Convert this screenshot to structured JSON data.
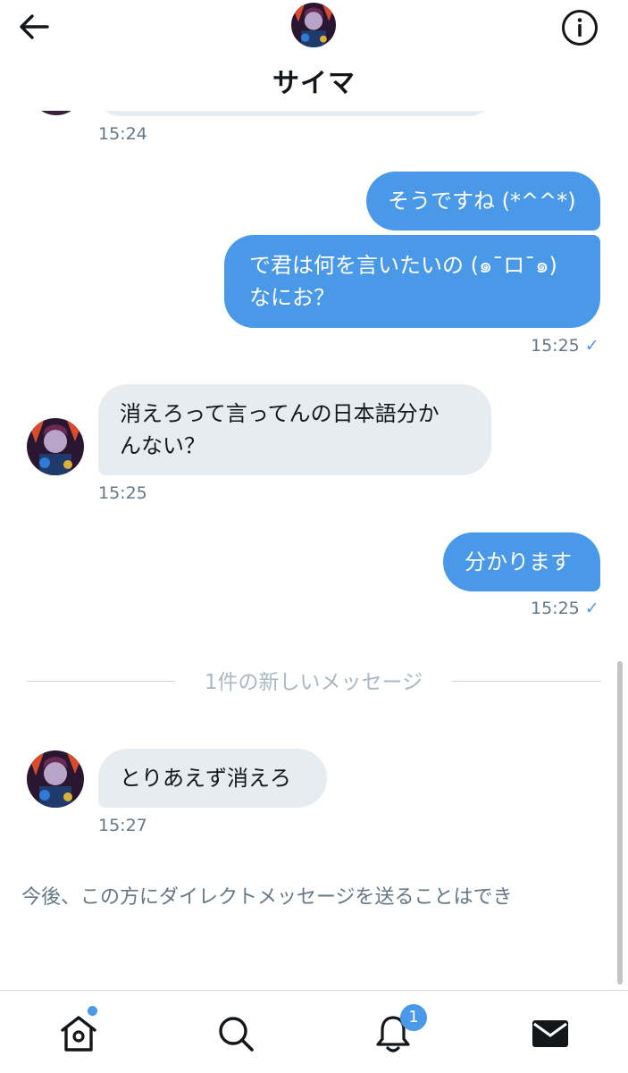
{
  "header": {
    "title": "サイマ",
    "back_icon": "arrow-left-icon",
    "info_icon": "info-icon"
  },
  "messages": [
    {
      "time": "15:24"
    },
    {
      "direction": "out",
      "text": "そうですね (*^^*)"
    },
    {
      "direction": "out",
      "text": "で君は何を言いたいの (๑¯ロ¯๑)\nなにお？",
      "time": "15:25",
      "read": true
    },
    {
      "direction": "in",
      "text": "消えろって言ってんの日本語分か\nんない？",
      "time": "15:25"
    },
    {
      "direction": "out",
      "text": "分かります",
      "time": "15:25",
      "read": true
    },
    {
      "direction": "in",
      "text": "とりあえず消えろ",
      "time": "15:27"
    }
  ],
  "divider": {
    "text": "1件の新しいメッセージ"
  },
  "notice": {
    "text": "今後、この方にダイレクトメッセージを送ることはでき"
  },
  "read_mark": "✓",
  "tabbar": {
    "home_icon": "home-icon",
    "search_icon": "search-icon",
    "notifications_icon": "bell-icon",
    "notifications_badge": "1",
    "messages_icon": "mail-icon"
  },
  "colors": {
    "accent": "#4a99e9",
    "incoming_bubble": "#e6ecf0",
    "muted_text": "#657786"
  }
}
